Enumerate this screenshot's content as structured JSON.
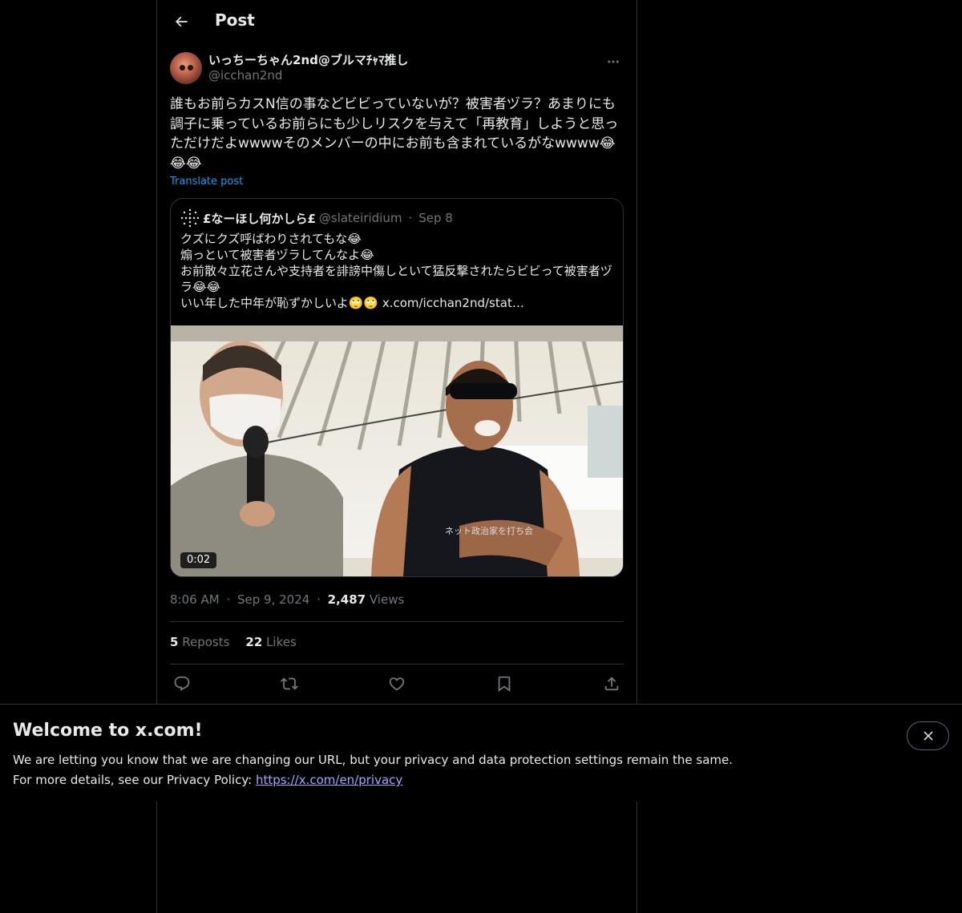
{
  "header": {
    "title": "Post"
  },
  "post": {
    "author": {
      "display_name": "いっちーちゃん2nd@ブルマﾁｬﾏ推し",
      "handle": "@icchan2nd"
    },
    "text": "誰もお前らカスN信の事などビビっていないが？被害者ヅラ？あまりにも調子に乗っているお前らにも少しリスクを与えて「再教育」しようと思っただけだよwwwwそのメンバーの中にお前も含まれているがなwwww😂😂😂",
    "translate_label": "Translate post",
    "quote": {
      "display_name": "£なーほし何かしら£",
      "handle": "@slateiridium",
      "separator": "·",
      "date": "Sep 8",
      "lines": [
        "クズにクズ呼ばわりされてもな😂",
        "煽っといて被害者ヅラしてんなよ😂",
        "お前散々立花さんや支持者を誹謗中傷しといて猛反撃されたらビビって被害者ヅラ😂😂",
        "いい年した中年が恥ずかしいよ🙄🙄 x.com/icchan2nd/stat…"
      ],
      "video_duration": "0:02",
      "shirt_text": "ネット政治家を打ち会"
    },
    "meta": {
      "time": "8:06 AM",
      "dot": "·",
      "date": "Sep 9, 2024",
      "views_count": "2,487",
      "views_label": "Views"
    },
    "stats": {
      "reposts_count": "5",
      "reposts_label": "Reposts",
      "likes_count": "22",
      "likes_label": "Likes"
    }
  },
  "banner": {
    "title": "Welcome to x.com!",
    "line1": "We are letting you know that we are changing our URL, but your privacy and data protection settings remain the same.",
    "line2_prefix": "For more details, see our Privacy Policy: ",
    "link": "https://x.com/en/privacy"
  },
  "colors": {
    "background": "#000000",
    "text": "#e7e9ea",
    "muted": "#71767b",
    "accent": "#1d9bf0",
    "border": "#2f3336",
    "link": "#a3a7ff"
  },
  "icons": [
    "back-arrow-icon",
    "more-icon",
    "reply-icon",
    "repost-icon",
    "like-icon",
    "bookmark-icon",
    "share-icon",
    "close-icon"
  ]
}
